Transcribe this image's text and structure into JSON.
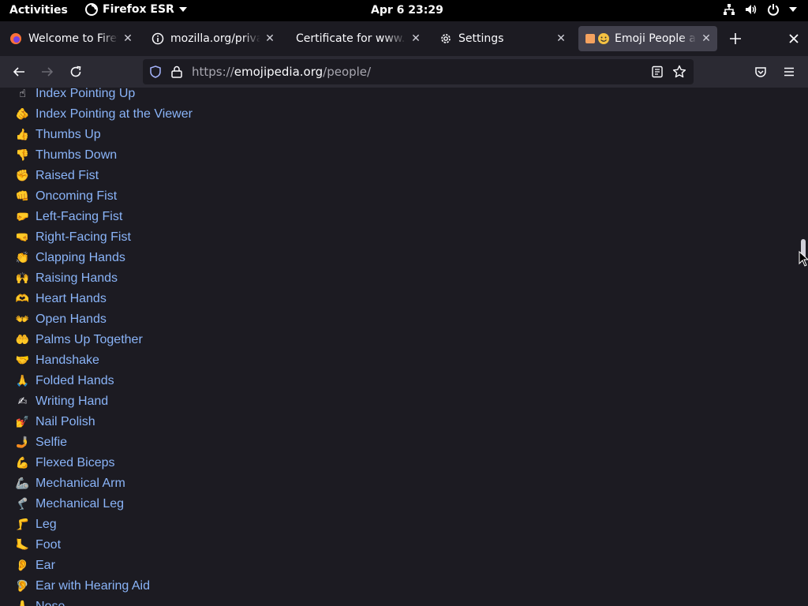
{
  "topbar": {
    "activities": "Activities",
    "app_name": "Firefox ESR",
    "clock": "Apr 6  23:29"
  },
  "tabs": [
    {
      "title": "Welcome to Firefox",
      "icon": "firefox-icon",
      "active": false
    },
    {
      "title": "mozilla.org/privacy",
      "icon": "info-icon",
      "active": false
    },
    {
      "title": "Certificate for www.mozilla.org",
      "icon": "none",
      "active": false
    },
    {
      "title": "Settings",
      "icon": "gear-icon",
      "active": false
    },
    {
      "title": "Emoji People and Body",
      "icon": "emojipedia-icon",
      "active": true
    }
  ],
  "navbar": {
    "url_scheme": "https://",
    "url_host": "emojipedia.org",
    "url_path": "/people/"
  },
  "emoji_items": [
    {
      "glyph": "☝",
      "label": "Index Pointing Up"
    },
    {
      "glyph": "🫵",
      "label": "Index Pointing at the Viewer"
    },
    {
      "glyph": "👍",
      "label": "Thumbs Up"
    },
    {
      "glyph": "👎",
      "label": "Thumbs Down"
    },
    {
      "glyph": "✊",
      "label": "Raised Fist"
    },
    {
      "glyph": "👊",
      "label": "Oncoming Fist"
    },
    {
      "glyph": "🤛",
      "label": "Left-Facing Fist"
    },
    {
      "glyph": "🤜",
      "label": "Right-Facing Fist"
    },
    {
      "glyph": "👏",
      "label": "Clapping Hands"
    },
    {
      "glyph": "🙌",
      "label": "Raising Hands"
    },
    {
      "glyph": "🫶",
      "label": "Heart Hands"
    },
    {
      "glyph": "👐",
      "label": "Open Hands"
    },
    {
      "glyph": "🤲",
      "label": "Palms Up Together"
    },
    {
      "glyph": "🤝",
      "label": "Handshake"
    },
    {
      "glyph": "🙏",
      "label": "Folded Hands"
    },
    {
      "glyph": "✍",
      "label": "Writing Hand"
    },
    {
      "glyph": "💅",
      "label": "Nail Polish"
    },
    {
      "glyph": "🤳",
      "label": "Selfie"
    },
    {
      "glyph": "💪",
      "label": "Flexed Biceps"
    },
    {
      "glyph": "🦾",
      "label": "Mechanical Arm"
    },
    {
      "glyph": "🦿",
      "label": "Mechanical Leg"
    },
    {
      "glyph": "🦵",
      "label": "Leg"
    },
    {
      "glyph": "🦶",
      "label": "Foot"
    },
    {
      "glyph": "👂",
      "label": "Ear"
    },
    {
      "glyph": "🦻",
      "label": "Ear with Hearing Aid"
    },
    {
      "glyph": "👃",
      "label": "Nose"
    }
  ],
  "colors": {
    "link": "#8ab4f8",
    "background": "#1c1b22",
    "toolbar": "#2b2a33",
    "active_tab": "#42414d"
  }
}
